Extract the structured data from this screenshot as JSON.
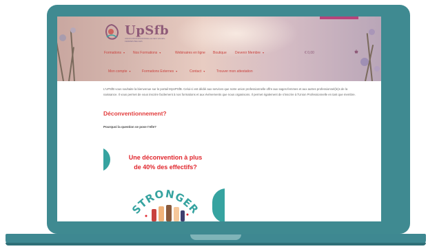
{
  "site": {
    "logo_text": "UpSfb",
    "logo_sub": "UNION PROFESSIONNELLE DES SAGES-FEMMES BELGES",
    "accent_color": "#c9413d",
    "brand_color": "#8e5a78"
  },
  "nav": {
    "row1": [
      {
        "label": "Formations",
        "dropdown": true
      },
      {
        "label": "Nos Formations",
        "dropdown": true
      },
      {
        "label": "Webinaires en ligne",
        "dropdown": false
      },
      {
        "label": "Boutique",
        "dropdown": false
      },
      {
        "label": "Devenir Membre",
        "dropdown": true
      }
    ],
    "row2": [
      {
        "label": "Mon compte",
        "dropdown": true
      },
      {
        "label": "Formations Externes",
        "dropdown": true
      },
      {
        "label": "Contact",
        "dropdown": true
      },
      {
        "label": "Trouver mon attestation",
        "dropdown": false
      }
    ],
    "cart_total": "€ 0,00",
    "cart_icon": "basket-icon"
  },
  "content": {
    "intro": "L'UPSfB vous souhaite la bienvenue sur le portail MyUPSfB. Celui-ci est dédié aux services que notre union professionnelle offre aux sages-femmes et aux autres professionnel(le)s de la naissance. Il vous permet de vous inscrire facilement à nos formations et aux événements que nous organisons. Il permet également de s'inscrire à l'Union Professionnelle en tant que membre.",
    "heading": "Déconventionnement?",
    "question": "Pourquoi la question se pose t'elle?",
    "poster": {
      "line1": "Une déconvention à plus",
      "line2": "de 40% des effectifs?",
      "banner": "STRONGER",
      "banner_color": "#36a3a0"
    }
  }
}
